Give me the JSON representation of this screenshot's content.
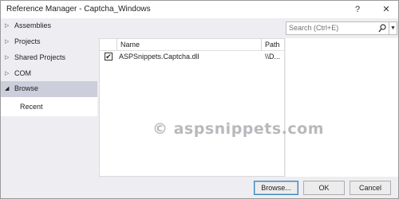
{
  "window": {
    "title": "Reference Manager - Captcha_Windows",
    "help_label": "?",
    "close_label": "✕"
  },
  "sidebar": {
    "items": [
      {
        "label": "Assemblies",
        "expanded": false
      },
      {
        "label": "Projects",
        "expanded": false
      },
      {
        "label": "Shared Projects",
        "expanded": false
      },
      {
        "label": "COM",
        "expanded": false
      },
      {
        "label": "Browse",
        "expanded": true
      }
    ],
    "subitem": "Recent"
  },
  "search": {
    "placeholder": "Search (Ctrl+E)"
  },
  "list": {
    "columns": [
      "Name",
      "Path"
    ],
    "rows": [
      {
        "checked": true,
        "name": "ASPSnippets.Captcha.dll",
        "path": "\\\\D..."
      }
    ]
  },
  "watermark": "© aspsnippets.com",
  "footer": {
    "browse": "Browse...",
    "ok": "OK",
    "cancel": "Cancel"
  },
  "colors": {
    "selected_nav": "#cccedb",
    "window_bg": "#eeeef2"
  }
}
